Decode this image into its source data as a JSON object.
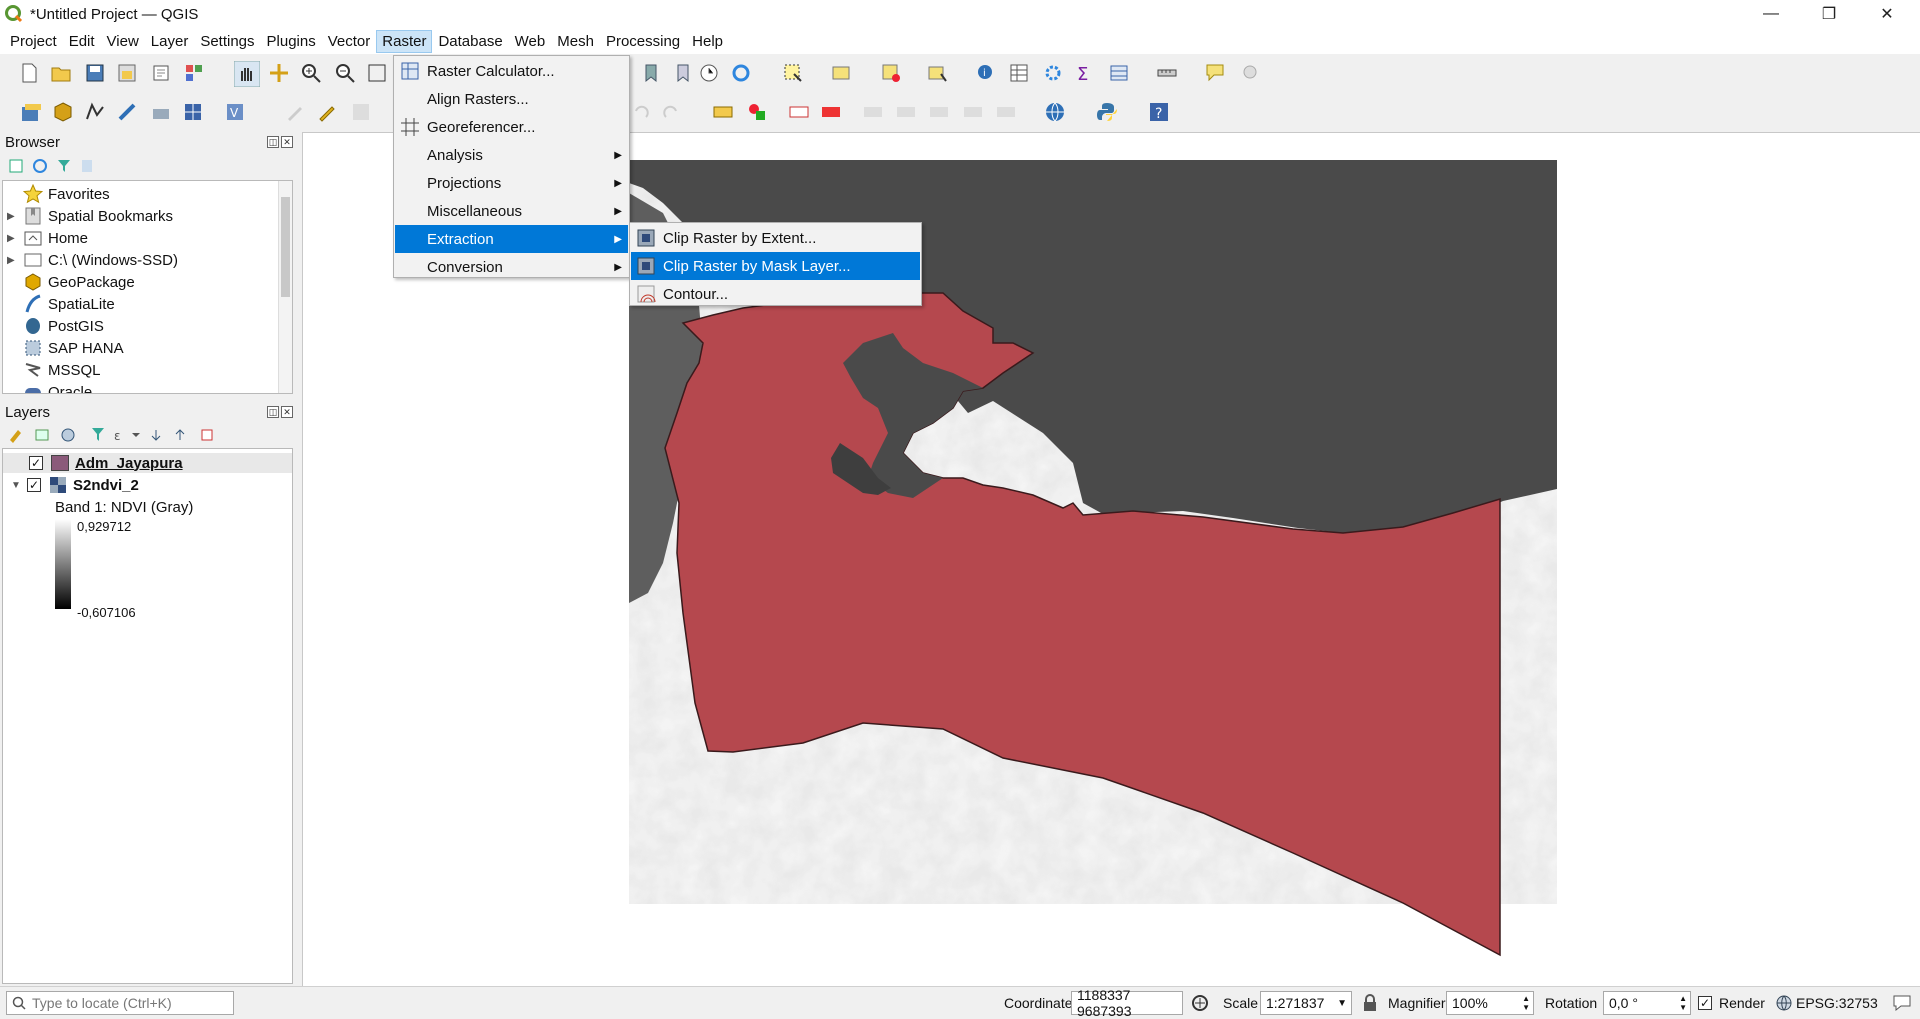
{
  "window": {
    "title": "*Untitled Project — QGIS",
    "controls": {
      "minimize": "—",
      "restore": "❐",
      "close": "✕"
    }
  },
  "menubar": [
    "Project",
    "Edit",
    "View",
    "Layer",
    "Settings",
    "Plugins",
    "Vector",
    "Raster",
    "Database",
    "Web",
    "Mesh",
    "Processing",
    "Help"
  ],
  "active_menu": "Raster",
  "raster_menu": [
    {
      "label": "Raster Calculator...",
      "icon": "raster-calculator-icon",
      "submenu": false
    },
    {
      "label": "Align Rasters...",
      "icon": "",
      "submenu": false
    },
    {
      "label": "Georeferencer...",
      "icon": "georeferencer-icon",
      "submenu": false
    },
    {
      "label": "Analysis",
      "icon": "",
      "submenu": true
    },
    {
      "label": "Projections",
      "icon": "",
      "submenu": true
    },
    {
      "label": "Miscellaneous",
      "icon": "",
      "submenu": true
    },
    {
      "label": "Extraction",
      "icon": "",
      "submenu": true,
      "highlighted": true
    },
    {
      "label": "Conversion",
      "icon": "",
      "submenu": true
    }
  ],
  "extraction_submenu": [
    {
      "label": "Clip Raster by Extent...",
      "icon": "clip-extent-icon"
    },
    {
      "label": "Clip Raster by Mask Layer...",
      "icon": "clip-mask-icon",
      "highlighted": true
    },
    {
      "label": "Contour...",
      "icon": "contour-icon"
    }
  ],
  "browser": {
    "title": "Browser",
    "items": [
      {
        "label": "Favorites",
        "icon": "star-icon",
        "expandable": false
      },
      {
        "label": "Spatial Bookmarks",
        "icon": "bookmark-icon",
        "expandable": true
      },
      {
        "label": "Home",
        "icon": "home-folder-icon",
        "expandable": true
      },
      {
        "label": "C:\\ (Windows-SSD)",
        "icon": "drive-icon",
        "expandable": true
      },
      {
        "label": "GeoPackage",
        "icon": "geopackage-icon",
        "expandable": false
      },
      {
        "label": "SpatiaLite",
        "icon": "spatialite-icon",
        "expandable": false
      },
      {
        "label": "PostGIS",
        "icon": "postgis-icon",
        "expandable": false
      },
      {
        "label": "SAP HANA",
        "icon": "sap-hana-icon",
        "expandable": false
      },
      {
        "label": "MSSQL",
        "icon": "mssql-icon",
        "expandable": false
      },
      {
        "label": "Oracle",
        "icon": "oracle-icon",
        "expandable": false
      }
    ]
  },
  "layers": {
    "title": "Layers",
    "items": [
      {
        "name": "Adm_Jayapura",
        "checked": true,
        "swatch": "#8b5a7a",
        "bold": true,
        "underline": true
      },
      {
        "name": "S2ndvi_2",
        "checked": true,
        "bold": true
      },
      {
        "name": "Band 1: NDVI (Gray)"
      }
    ],
    "legend": {
      "max": "0,929712",
      "min": "-0,607106"
    }
  },
  "statusbar": {
    "locate_placeholder": "Type to locate (Ctrl+K)",
    "coordinate_label": "Coordinate",
    "coordinate_value": "1188337 9687393",
    "scale_label": "Scale",
    "scale_value": "1:271837",
    "magnifier_label": "Magnifier",
    "magnifier_value": "100%",
    "rotation_label": "Rotation",
    "rotation_value": "0,0 °",
    "render_label": "Render",
    "render_checked": true,
    "crs": "EPSG:32753"
  },
  "colors": {
    "polygon_fill": "#b5484e",
    "menu_highlight": "#0078d7",
    "water": "#3a3a3a"
  }
}
